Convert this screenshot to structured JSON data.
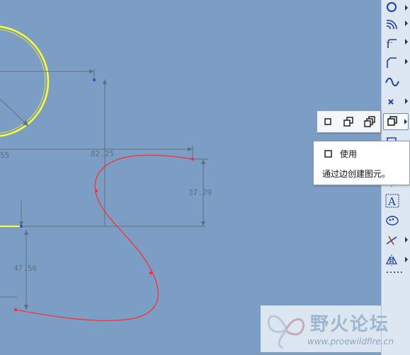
{
  "canvas": {
    "background": "#7d9ec4",
    "dimensions": {
      "top_left": "55",
      "horizontal": "82.25",
      "vertical_right": "37.79",
      "vertical_left": "47.56"
    },
    "colors": {
      "circle": "#ffff33",
      "spline": "#ff2a2a",
      "dimension": "#5f6f80",
      "point": "#2d4fd0"
    }
  },
  "toolbar": {
    "buttons": [
      {
        "icon": "circle-icon"
      },
      {
        "icon": "arc-icon"
      },
      {
        "icon": "fillet-icon"
      },
      {
        "icon": "chamfer-icon"
      },
      {
        "icon": "spline-icon"
      },
      {
        "icon": "point-icon"
      },
      {
        "icon": "use-edge-icon",
        "active": true
      },
      {
        "icon": "offset-icon"
      },
      {
        "icon": "centerline-icon"
      },
      {
        "icon": "text-icon"
      },
      {
        "icon": "palette-icon"
      },
      {
        "icon": "trim-icon"
      },
      {
        "icon": "mirror-icon"
      },
      {
        "icon": "more-icon"
      }
    ]
  },
  "flyout": {
    "items": [
      {
        "icon": "use-edge-icon"
      },
      {
        "icon": "offset-edge-icon"
      },
      {
        "icon": "thicken-edge-icon"
      }
    ]
  },
  "tooltip": {
    "title": "使用",
    "description": "通过边创建图元。"
  },
  "watermark": {
    "name": "野火论坛",
    "url": "www.proewildfire.cn"
  }
}
